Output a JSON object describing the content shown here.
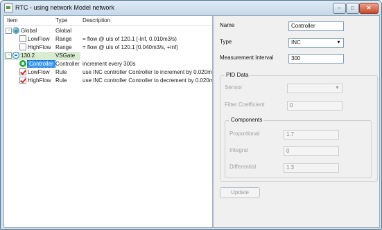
{
  "window": {
    "title": "RTC -  using network Model network"
  },
  "titlebar": {
    "min_glyph": "–",
    "max_glyph": "□",
    "close_glyph": "✕"
  },
  "tree": {
    "columns": [
      "Item",
      "Type",
      "Description"
    ],
    "rows": [
      {
        "icon": "globe-icon",
        "name": "Global",
        "type": "Global",
        "description": "",
        "expander": "−"
      },
      {
        "icon": "range-icon",
        "name": "LowFlow",
        "type": "Range",
        "description": "= flow @ u/s of 120.1 [-Inf, 0.010m3/s)"
      },
      {
        "icon": "range-icon",
        "name": "HighFlow",
        "type": "Range",
        "description": "= flow @ u/s of 120.1 [0.040m3/s, +Inf)"
      },
      {
        "icon": "node-icon",
        "name": "130.2",
        "type": "VSGate",
        "description": "",
        "expander": "−"
      },
      {
        "icon": "controller-icon",
        "name": "Controller",
        "type": "Controller",
        "description": "increment every 300s"
      },
      {
        "icon": "rule-icon",
        "name": "LowFlow",
        "type": "Rule",
        "description": "use INC controller Controller to increment by 0.020m"
      },
      {
        "icon": "rule-icon",
        "name": "HighFlow",
        "type": "Rule",
        "description": "use INC controller Controller to decrement by 0.020m"
      }
    ]
  },
  "form": {
    "name_label": "Name",
    "name_value": "Controller",
    "type_label": "Type",
    "type_value": "INC",
    "interval_label": "Measurement Interval",
    "interval_value": "300",
    "pid_title": "PID Data",
    "sensor_label": "Sensor",
    "sensor_value": "",
    "filter_label": "Filter Coefficient",
    "filter_value": "0",
    "components_title": "Components",
    "proportional_label": "Proportional",
    "proportional_value": "1.7",
    "integral_label": "Integral",
    "integral_value": "0",
    "differential_label": "Differential",
    "differential_value": "1.3",
    "update_label": "Update",
    "dropdown_arrow": "▼"
  }
}
